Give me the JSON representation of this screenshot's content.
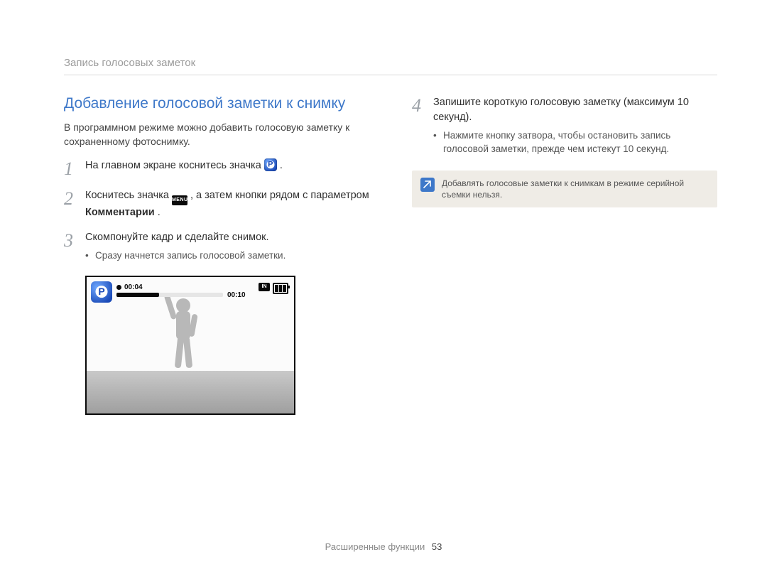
{
  "section_header": "Запись голосовых заметок",
  "heading": "Добавление голосовой заметки к снимку",
  "intro": "В программном режиме можно добавить голосовую заметку к сохраненному фотоснимку.",
  "steps_left": [
    {
      "num": "1",
      "text_before": "На главном экране коснитесь значка ",
      "text_after": "."
    },
    {
      "num": "2",
      "text_before": "Коснитесь значка ",
      "text_mid": ", а затем кнопки рядом с параметром ",
      "bold": "Комментарии",
      "text_after": "."
    },
    {
      "num": "3",
      "text_before": "Скомпонуйте кадр и сделайте снимок.",
      "bullets": [
        "Сразу начнется запись голосовой заметки."
      ]
    }
  ],
  "steps_right": [
    {
      "num": "4",
      "text_before": "Запишите короткую голосовую заметку (максимум 10 секунд).",
      "bullets": [
        "Нажмите кнопку затвора, чтобы остановить запись голосовой заметки, прежде чем истекут 10 секунд."
      ]
    }
  ],
  "note": "Добавлять голосовые заметки к снимкам в режиме серийной съемки нельзя.",
  "camera_preview": {
    "elapsed": "00:04",
    "total": "00:10",
    "memory_label": "IN"
  },
  "icon_labels": {
    "menu": "MENU"
  },
  "footer": {
    "label": "Расширенные функции",
    "page": "53"
  }
}
